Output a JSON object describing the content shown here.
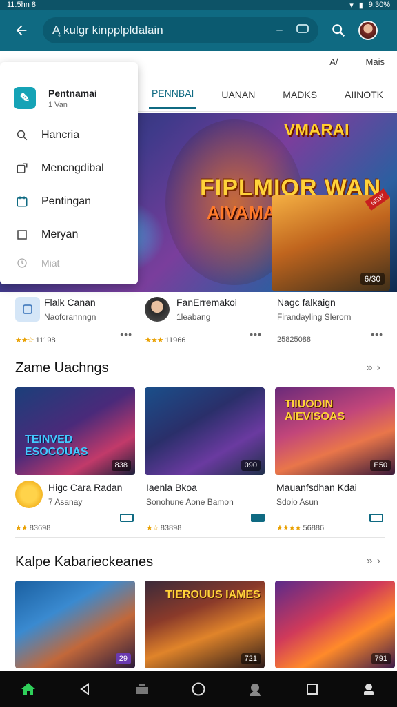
{
  "status_bar": {
    "left_text": "11.5hn 8",
    "right_text": "9.30%"
  },
  "header": {
    "search_query": "Ą kulgr kinpplpldalain",
    "icons": [
      "back-arrow-icon",
      "tune-icon",
      "message-icon",
      "search-icon",
      "avatar"
    ]
  },
  "top_links": [
    "A/",
    "Mais"
  ],
  "tabs": [
    {
      "label": "PENNBAI",
      "active": true
    },
    {
      "label": "UANAN",
      "active": false
    },
    {
      "label": "MADKS",
      "active": false
    },
    {
      "label": "AIINOTK",
      "active": false
    }
  ],
  "dropdown": {
    "app_title": "Pentnamai",
    "app_subtitle": "1 Van",
    "items": [
      {
        "label": "Hancria",
        "icon": "search-icon"
      },
      {
        "label": "Mencngdibal",
        "icon": "share-icon"
      },
      {
        "label": "Pentingan",
        "icon": "calendar-icon"
      },
      {
        "label": "Meryan",
        "icon": "square-icon"
      },
      {
        "label": "Miat",
        "icon": "clock-icon"
      }
    ]
  },
  "hero": {
    "title": "FIPLMIOR WAN",
    "subtitle": "AIVAMAI",
    "logo": "VMARAI",
    "ribbon": "NEW",
    "badge": "6/30"
  },
  "featured_apps": [
    {
      "name": "Flalk Canan",
      "subtitle": "Naofcrannngn",
      "rating": "11198",
      "stars": "★★☆"
    },
    {
      "name": "FanErremakoi",
      "subtitle": "1leabang",
      "rating": "11966",
      "stars": "★★★"
    },
    {
      "name": "Nagc falkaign",
      "subtitle": "Firandayling Slerorn",
      "rating": "25825088",
      "stars": ""
    }
  ],
  "section1": {
    "title": "Zame Uachngs",
    "cards": [
      {
        "art_title": "TEINVED ESOCOUAS",
        "badge": "838"
      },
      {
        "art_title": "",
        "badge": "090"
      },
      {
        "art_title": "TIIUODIN AIEVISOAS",
        "badge": "E50"
      }
    ],
    "games": [
      {
        "name": "Higc Cara Radan",
        "subtitle": "7 Asanay",
        "rating": "83698",
        "stars": "★★"
      },
      {
        "name": "Iaenla Bkoa",
        "subtitle": "Sonohune Aone Bamon",
        "rating": "83898",
        "stars": "★☆"
      },
      {
        "name": "Mauanfsdhan Kdai",
        "subtitle": "Sdoio Asun",
        "rating": "56886",
        "stars": "★★★★"
      }
    ]
  },
  "section2": {
    "title": "Kalpe Kabariеckeanes",
    "cards": [
      {
        "art_title": "",
        "badge": "29"
      },
      {
        "art_title": "TIEROUUS IAMES",
        "badge": "721"
      },
      {
        "art_title": "",
        "badge": "791"
      }
    ]
  },
  "nav": [
    "home-icon",
    "back-icon",
    "recents-icon",
    "circle-home-icon",
    "profile-icon",
    "square-icon",
    "account-icon"
  ],
  "colors": {
    "app_bar": "#0f6a82",
    "accent": "#0f6a82",
    "star": "#e9a000"
  }
}
